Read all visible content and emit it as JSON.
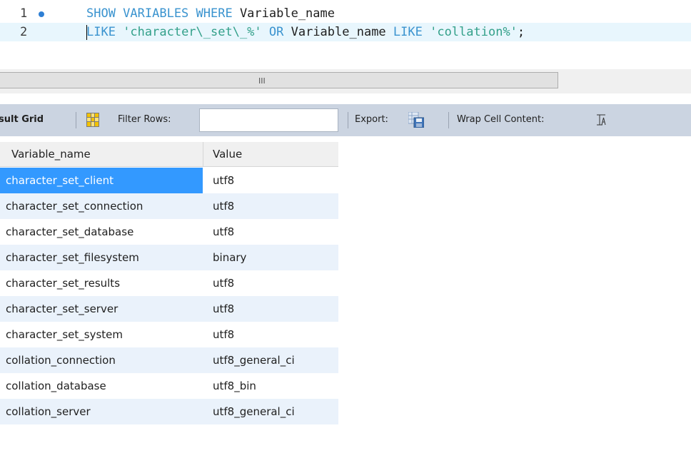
{
  "editor": {
    "lines": [
      {
        "number": "1",
        "tokens": [
          {
            "text": "SHOW VARIABLES WHERE ",
            "kind": "kw"
          },
          {
            "text": "Variable_name",
            "kind": "id"
          }
        ]
      },
      {
        "number": "2",
        "tokens": [
          {
            "text": "LIKE ",
            "kind": "kw"
          },
          {
            "text": "'character\\_set\\_%'",
            "kind": "str"
          },
          {
            "text": " OR ",
            "kind": "kw"
          },
          {
            "text": "Variable_name",
            "kind": "id"
          },
          {
            "text": " LIKE ",
            "kind": "kw"
          },
          {
            "text": "'collation%'",
            "kind": "str"
          },
          {
            "text": ";",
            "kind": "id"
          }
        ]
      }
    ],
    "scroll_grip": "III"
  },
  "toolbar": {
    "result_grid_label": "sult Grid",
    "filter_rows_label": "Filter Rows:",
    "filter_rows_value": "",
    "export_label": "Export:",
    "wrap_label": "Wrap Cell Content:"
  },
  "grid": {
    "columns": [
      "Variable_name",
      "Value"
    ],
    "rows": [
      [
        "character_set_client",
        "utf8"
      ],
      [
        "character_set_connection",
        "utf8"
      ],
      [
        "character_set_database",
        "utf8"
      ],
      [
        "character_set_filesystem",
        "binary"
      ],
      [
        "character_set_results",
        "utf8"
      ],
      [
        "character_set_server",
        "utf8"
      ],
      [
        "character_set_system",
        "utf8"
      ],
      [
        "collation_connection",
        "utf8_general_ci"
      ],
      [
        "collation_database",
        "utf8_bin"
      ],
      [
        "collation_server",
        "utf8_general_ci"
      ]
    ],
    "selected_cell": "character_set_client"
  },
  "colors": {
    "keyword": "#3a93cf",
    "string": "#33a08a",
    "selection": "#3399ff",
    "toolbar_bg": "#cbd4e1",
    "alt_row": "#eaf2fb"
  },
  "icons": [
    "breakpoint-dot-icon",
    "result-grid-icon",
    "export-icon",
    "wrap-cell-icon"
  ]
}
